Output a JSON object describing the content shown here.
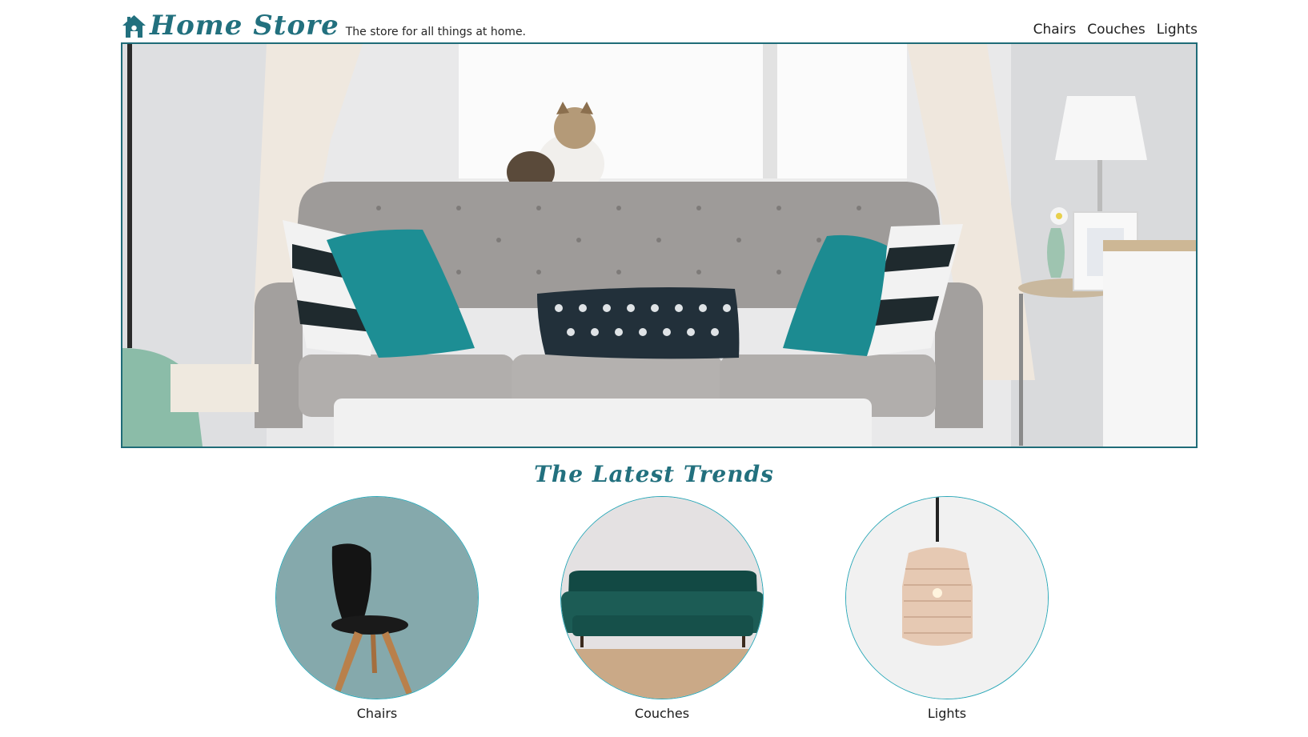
{
  "header": {
    "logo_icon": "house-icon",
    "brand_name": "Home Store",
    "tagline": "The store for all things at home.",
    "nav": [
      {
        "label": "Chairs"
      },
      {
        "label": "Couches"
      },
      {
        "label": "Lights"
      }
    ]
  },
  "hero": {
    "image": "living-room-sofa-photo"
  },
  "trends": {
    "title": "The Latest Trends",
    "items": [
      {
        "label": "Chairs",
        "image": "black-chair-photo"
      },
      {
        "label": "Couches",
        "image": "green-velvet-couch-photo"
      },
      {
        "label": "Lights",
        "image": "rattan-pendant-lamp-photo"
      }
    ]
  },
  "colors": {
    "accent": "#22707e",
    "hero_border": "#1f6c78",
    "circle_border": "#2aa7b7"
  }
}
